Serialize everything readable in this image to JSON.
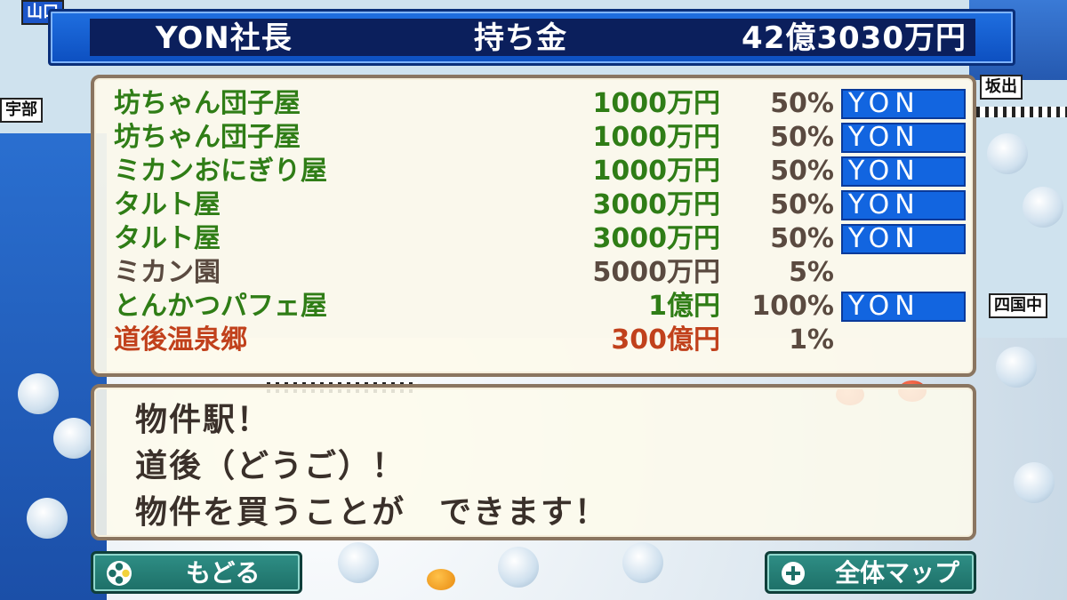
{
  "header": {
    "player": "YON社長",
    "money_label": "持ち金",
    "money": "42億3030万円"
  },
  "properties": [
    {
      "name": "坊ちゃん団子屋",
      "price": "1000万円",
      "share": "50%",
      "owner": "YON",
      "color": "#2f7d16"
    },
    {
      "name": "坊ちゃん団子屋",
      "price": "1000万円",
      "share": "50%",
      "owner": "YON",
      "color": "#2f7d16"
    },
    {
      "name": "ミカンおにぎり屋",
      "price": "1000万円",
      "share": "50%",
      "owner": "YON",
      "color": "#2f7d16"
    },
    {
      "name": "タルト屋",
      "price": "3000万円",
      "share": "50%",
      "owner": "YON",
      "color": "#2f7d16"
    },
    {
      "name": "タルト屋",
      "price": "3000万円",
      "share": "50%",
      "owner": "YON",
      "color": "#2f7d16"
    },
    {
      "name": "ミカン園",
      "price": "5000万円",
      "share": "5%",
      "owner": "",
      "color": "#5a4a40"
    },
    {
      "name": "とんかつパフェ屋",
      "price": "1億円",
      "share": "100%",
      "owner": "YON",
      "color": "#2f7d16"
    },
    {
      "name": "道後温泉郷",
      "price": "300億円",
      "share": "1%",
      "owner": "",
      "color": "#c1411c"
    }
  ],
  "message": {
    "line1": "物件駅！",
    "line2": "道後（どうご）！",
    "line3": "物件を買うことが　できます！"
  },
  "buttons": {
    "back_label": "もどる",
    "back_icon": "controller-buttons-icon",
    "map_label": "全体マップ",
    "map_icon": "plus-circle-icon"
  },
  "board_labels": {
    "left_top": "山口",
    "left_mid": "宇部",
    "right_top": "坂出",
    "right_mid": "四国中"
  }
}
